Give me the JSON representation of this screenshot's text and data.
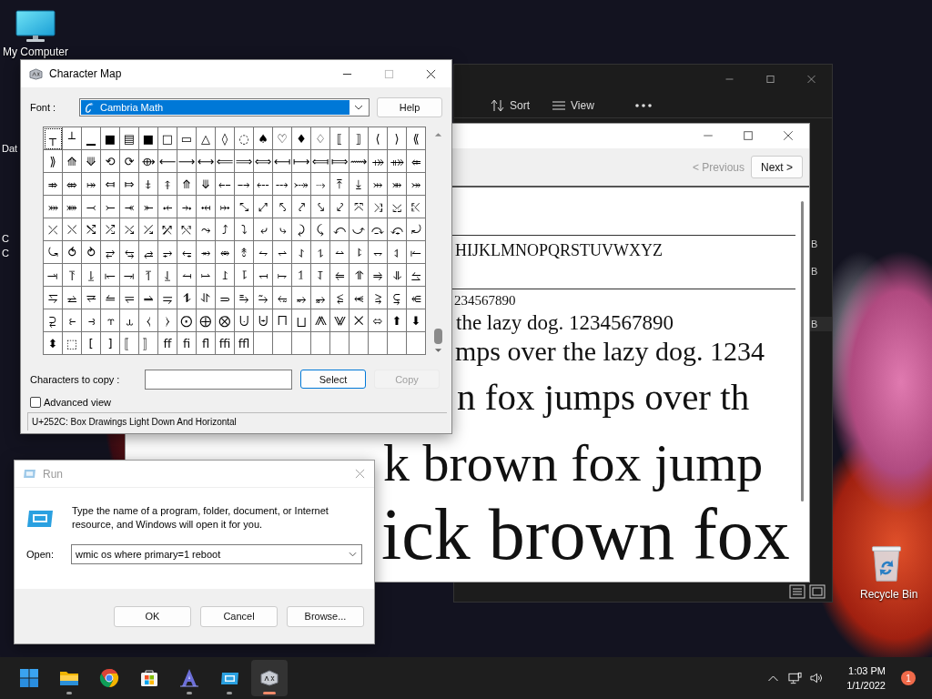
{
  "desktop": {
    "my_computer": "My Computer",
    "fragments": [
      {
        "label": "Dat"
      },
      {
        "label": "C"
      },
      {
        "label": "C"
      }
    ],
    "recycle_bin": "Recycle Bin"
  },
  "explorer": {
    "toolbar": [
      {
        "kind": "sort",
        "label": "Sort"
      },
      {
        "kind": "view",
        "label": "View"
      }
    ],
    "size_fragments": [
      "B",
      "B",
      "B"
    ]
  },
  "font_viewer": {
    "buttons": [
      {
        "label": "< Previous",
        "disabled": true
      },
      {
        "label": "Next >",
        "disabled": false
      }
    ],
    "sample_groups": [
      [
        "HIJKLMNOPQRSTUVWXYZ"
      ],
      [
        "234567890",
        "the lazy dog. 1234567890",
        "mps over the lazy dog. 1234",
        "n fox jumps over th",
        "k brown fox jump",
        "ick brown fox"
      ]
    ]
  },
  "character_map": {
    "title": "Character Map",
    "font_label": "Font :",
    "font": "Cambria Math",
    "help": "Help",
    "grid": [
      [
        {
          "ch": "┬",
          "selected": true
        },
        {
          "ch": "┴",
          "selected": false
        },
        {
          "ch": "▁",
          "selected": false
        },
        {
          "ch": "■",
          "selected": false
        },
        {
          "ch": "▤",
          "selected": false
        },
        {
          "ch": "■",
          "selected": false
        },
        {
          "ch": "□",
          "selected": false
        },
        {
          "ch": "▭",
          "selected": false
        },
        {
          "ch": "△",
          "selected": false
        },
        {
          "ch": "◊",
          "selected": false
        },
        {
          "ch": "◌",
          "selected": false
        },
        {
          "ch": "♠",
          "selected": false
        },
        {
          "ch": "♡",
          "selected": false
        },
        {
          "ch": "♦",
          "selected": false
        },
        {
          "ch": "♢",
          "selected": false
        },
        {
          "ch": "⟦",
          "selected": false
        },
        {
          "ch": "⟧",
          "selected": false
        },
        {
          "ch": "⟨",
          "selected": false
        },
        {
          "ch": "⟩",
          "selected": false
        },
        {
          "ch": "⟪",
          "selected": false
        }
      ],
      [
        {
          "ch": "⟫",
          "selected": false
        },
        {
          "ch": "⟰",
          "selected": false
        },
        {
          "ch": "⟱",
          "selected": false
        },
        {
          "ch": "⟲",
          "selected": false
        },
        {
          "ch": "⟳",
          "selected": false
        },
        {
          "ch": "⟴",
          "selected": false
        },
        {
          "ch": "⟵",
          "selected": false
        },
        {
          "ch": "⟶",
          "selected": false
        },
        {
          "ch": "⟷",
          "selected": false
        },
        {
          "ch": "⟸",
          "selected": false
        },
        {
          "ch": "⟹",
          "selected": false
        },
        {
          "ch": "⟺",
          "selected": false
        },
        {
          "ch": "⟻",
          "selected": false
        },
        {
          "ch": "⟼",
          "selected": false
        },
        {
          "ch": "⟽",
          "selected": false
        },
        {
          "ch": "⟾",
          "selected": false
        },
        {
          "ch": "⟿",
          "selected": false
        },
        {
          "ch": "⤀",
          "selected": false
        },
        {
          "ch": "⤁",
          "selected": false
        },
        {
          "ch": "⤂",
          "selected": false
        }
      ],
      [
        {
          "ch": "⤃",
          "selected": false
        },
        {
          "ch": "⤄",
          "selected": false
        },
        {
          "ch": "⤅",
          "selected": false
        },
        {
          "ch": "⤆",
          "selected": false
        },
        {
          "ch": "⤇",
          "selected": false
        },
        {
          "ch": "⤈",
          "selected": false
        },
        {
          "ch": "⤉",
          "selected": false
        },
        {
          "ch": "⤊",
          "selected": false
        },
        {
          "ch": "⤋",
          "selected": false
        },
        {
          "ch": "⤌",
          "selected": false
        },
        {
          "ch": "⤍",
          "selected": false
        },
        {
          "ch": "⤎",
          "selected": false
        },
        {
          "ch": "⤏",
          "selected": false
        },
        {
          "ch": "⤐",
          "selected": false
        },
        {
          "ch": "⤑",
          "selected": false
        },
        {
          "ch": "⤒",
          "selected": false
        },
        {
          "ch": "⤓",
          "selected": false
        },
        {
          "ch": "⤔",
          "selected": false
        },
        {
          "ch": "⤕",
          "selected": false
        },
        {
          "ch": "⤖",
          "selected": false
        }
      ],
      [
        {
          "ch": "⤗",
          "selected": false
        },
        {
          "ch": "⤘",
          "selected": false
        },
        {
          "ch": "⤙",
          "selected": false
        },
        {
          "ch": "⤚",
          "selected": false
        },
        {
          "ch": "⤛",
          "selected": false
        },
        {
          "ch": "⤜",
          "selected": false
        },
        {
          "ch": "⤝",
          "selected": false
        },
        {
          "ch": "⤞",
          "selected": false
        },
        {
          "ch": "⤟",
          "selected": false
        },
        {
          "ch": "⤠",
          "selected": false
        },
        {
          "ch": "⤡",
          "selected": false
        },
        {
          "ch": "⤢",
          "selected": false
        },
        {
          "ch": "⤣",
          "selected": false
        },
        {
          "ch": "⤤",
          "selected": false
        },
        {
          "ch": "⤥",
          "selected": false
        },
        {
          "ch": "⤦",
          "selected": false
        },
        {
          "ch": "⤧",
          "selected": false
        },
        {
          "ch": "⤨",
          "selected": false
        },
        {
          "ch": "⤩",
          "selected": false
        },
        {
          "ch": "⤪",
          "selected": false
        }
      ],
      [
        {
          "ch": "⤫",
          "selected": false
        },
        {
          "ch": "⤬",
          "selected": false
        },
        {
          "ch": "⤭",
          "selected": false
        },
        {
          "ch": "⤮",
          "selected": false
        },
        {
          "ch": "⤯",
          "selected": false
        },
        {
          "ch": "⤰",
          "selected": false
        },
        {
          "ch": "⤱",
          "selected": false
        },
        {
          "ch": "⤲",
          "selected": false
        },
        {
          "ch": "⤳",
          "selected": false
        },
        {
          "ch": "⤴",
          "selected": false
        },
        {
          "ch": "⤵",
          "selected": false
        },
        {
          "ch": "⤶",
          "selected": false
        },
        {
          "ch": "⤷",
          "selected": false
        },
        {
          "ch": "⤸",
          "selected": false
        },
        {
          "ch": "⤹",
          "selected": false
        },
        {
          "ch": "⤺",
          "selected": false
        },
        {
          "ch": "⤻",
          "selected": false
        },
        {
          "ch": "⤼",
          "selected": false
        },
        {
          "ch": "⤽",
          "selected": false
        },
        {
          "ch": "⤾",
          "selected": false
        }
      ],
      [
        {
          "ch": "⤿",
          "selected": false
        },
        {
          "ch": "⥀",
          "selected": false
        },
        {
          "ch": "⥁",
          "selected": false
        },
        {
          "ch": "⥂",
          "selected": false
        },
        {
          "ch": "⥃",
          "selected": false
        },
        {
          "ch": "⥄",
          "selected": false
        },
        {
          "ch": "⥅",
          "selected": false
        },
        {
          "ch": "⥆",
          "selected": false
        },
        {
          "ch": "⥇",
          "selected": false
        },
        {
          "ch": "⥈",
          "selected": false
        },
        {
          "ch": "⥉",
          "selected": false
        },
        {
          "ch": "⥊",
          "selected": false
        },
        {
          "ch": "⥋",
          "selected": false
        },
        {
          "ch": "⥌",
          "selected": false
        },
        {
          "ch": "⥍",
          "selected": false
        },
        {
          "ch": "⥎",
          "selected": false
        },
        {
          "ch": "⥏",
          "selected": false
        },
        {
          "ch": "⥐",
          "selected": false
        },
        {
          "ch": "⥑",
          "selected": false
        },
        {
          "ch": "⥒",
          "selected": false
        }
      ],
      [
        {
          "ch": "⥓",
          "selected": false
        },
        {
          "ch": "⥔",
          "selected": false
        },
        {
          "ch": "⥕",
          "selected": false
        },
        {
          "ch": "⥖",
          "selected": false
        },
        {
          "ch": "⥗",
          "selected": false
        },
        {
          "ch": "⥘",
          "selected": false
        },
        {
          "ch": "⥙",
          "selected": false
        },
        {
          "ch": "⥚",
          "selected": false
        },
        {
          "ch": "⥛",
          "selected": false
        },
        {
          "ch": "⥜",
          "selected": false
        },
        {
          "ch": "⥝",
          "selected": false
        },
        {
          "ch": "⥞",
          "selected": false
        },
        {
          "ch": "⥟",
          "selected": false
        },
        {
          "ch": "⥠",
          "selected": false
        },
        {
          "ch": "⥡",
          "selected": false
        },
        {
          "ch": "⥢",
          "selected": false
        },
        {
          "ch": "⥣",
          "selected": false
        },
        {
          "ch": "⥤",
          "selected": false
        },
        {
          "ch": "⥥",
          "selected": false
        },
        {
          "ch": "⥦",
          "selected": false
        }
      ],
      [
        {
          "ch": "⥧",
          "selected": false
        },
        {
          "ch": "⥨",
          "selected": false
        },
        {
          "ch": "⥩",
          "selected": false
        },
        {
          "ch": "⥪",
          "selected": false
        },
        {
          "ch": "⥫",
          "selected": false
        },
        {
          "ch": "⥬",
          "selected": false
        },
        {
          "ch": "⥭",
          "selected": false
        },
        {
          "ch": "⥮",
          "selected": false
        },
        {
          "ch": "⥯",
          "selected": false
        },
        {
          "ch": "⥰",
          "selected": false
        },
        {
          "ch": "⥱",
          "selected": false
        },
        {
          "ch": "⥲",
          "selected": false
        },
        {
          "ch": "⥳",
          "selected": false
        },
        {
          "ch": "⥴",
          "selected": false
        },
        {
          "ch": "⥵",
          "selected": false
        },
        {
          "ch": "⥶",
          "selected": false
        },
        {
          "ch": "⥷",
          "selected": false
        },
        {
          "ch": "⥸",
          "selected": false
        },
        {
          "ch": "⥹",
          "selected": false
        },
        {
          "ch": "⥺",
          "selected": false
        }
      ],
      [
        {
          "ch": "⥻",
          "selected": false
        },
        {
          "ch": "⥼",
          "selected": false
        },
        {
          "ch": "⥽",
          "selected": false
        },
        {
          "ch": "⥾",
          "selected": false
        },
        {
          "ch": "⥿",
          "selected": false
        },
        {
          "ch": "⧼",
          "selected": false
        },
        {
          "ch": "⧽",
          "selected": false
        },
        {
          "ch": "⨀",
          "selected": false
        },
        {
          "ch": "⨁",
          "selected": false
        },
        {
          "ch": "⨂",
          "selected": false
        },
        {
          "ch": "⨃",
          "selected": false
        },
        {
          "ch": "⨄",
          "selected": false
        },
        {
          "ch": "⨅",
          "selected": false
        },
        {
          "ch": "⨆",
          "selected": false
        },
        {
          "ch": "⨇",
          "selected": false
        },
        {
          "ch": "⨈",
          "selected": false
        },
        {
          "ch": "⨉",
          "selected": false
        },
        {
          "ch": "⬄",
          "selected": false
        },
        {
          "ch": "⬆",
          "selected": false
        },
        {
          "ch": "⬇",
          "selected": false
        }
      ],
      [
        {
          "ch": "⬍",
          "selected": false
        },
        {
          "ch": "⬚",
          "selected": false
        },
        {
          "ch": "[",
          "selected": false
        },
        {
          "ch": "]",
          "selected": false
        },
        {
          "ch": "〚",
          "selected": false
        },
        {
          "ch": "〛",
          "selected": false
        },
        {
          "ch": "ﬀ",
          "selected": false
        },
        {
          "ch": "ﬁ",
          "selected": false
        },
        {
          "ch": "ﬂ",
          "selected": false
        },
        {
          "ch": "ﬃ",
          "selected": false
        },
        {
          "ch": "ﬄ",
          "selected": false
        }
      ]
    ],
    "copy_label": "Characters to copy :",
    "buttons": [
      {
        "label": "Select",
        "focused": true,
        "disabled": false
      },
      {
        "label": "Copy",
        "focused": false,
        "disabled": true
      }
    ],
    "advanced_view": {
      "label": "Advanced view",
      "checked": false
    },
    "status": "U+252C: Box Drawings Light Down And Horizontal"
  },
  "run": {
    "title": "Run",
    "message": "Type the name of a program, folder, document, or Internet resource, and Windows will open it for you.",
    "open_label": "Open:",
    "command": "wmic os where primary=1 reboot",
    "buttons": [
      "OK",
      "Cancel",
      "Browse..."
    ]
  },
  "taskbar": {
    "apps": [
      {
        "kind": "start",
        "running": false,
        "active": false
      },
      {
        "kind": "folder",
        "running": true,
        "active": false
      },
      {
        "kind": "chrome",
        "running": false,
        "active": false
      },
      {
        "kind": "store",
        "running": false,
        "active": false
      },
      {
        "kind": "alpha",
        "running": true,
        "active": false
      },
      {
        "kind": "run",
        "running": true,
        "active": false
      },
      {
        "kind": "charmap",
        "running": true,
        "active": true
      }
    ],
    "time": "1:03 PM",
    "date": "1/1/2022",
    "notifications": "1"
  }
}
